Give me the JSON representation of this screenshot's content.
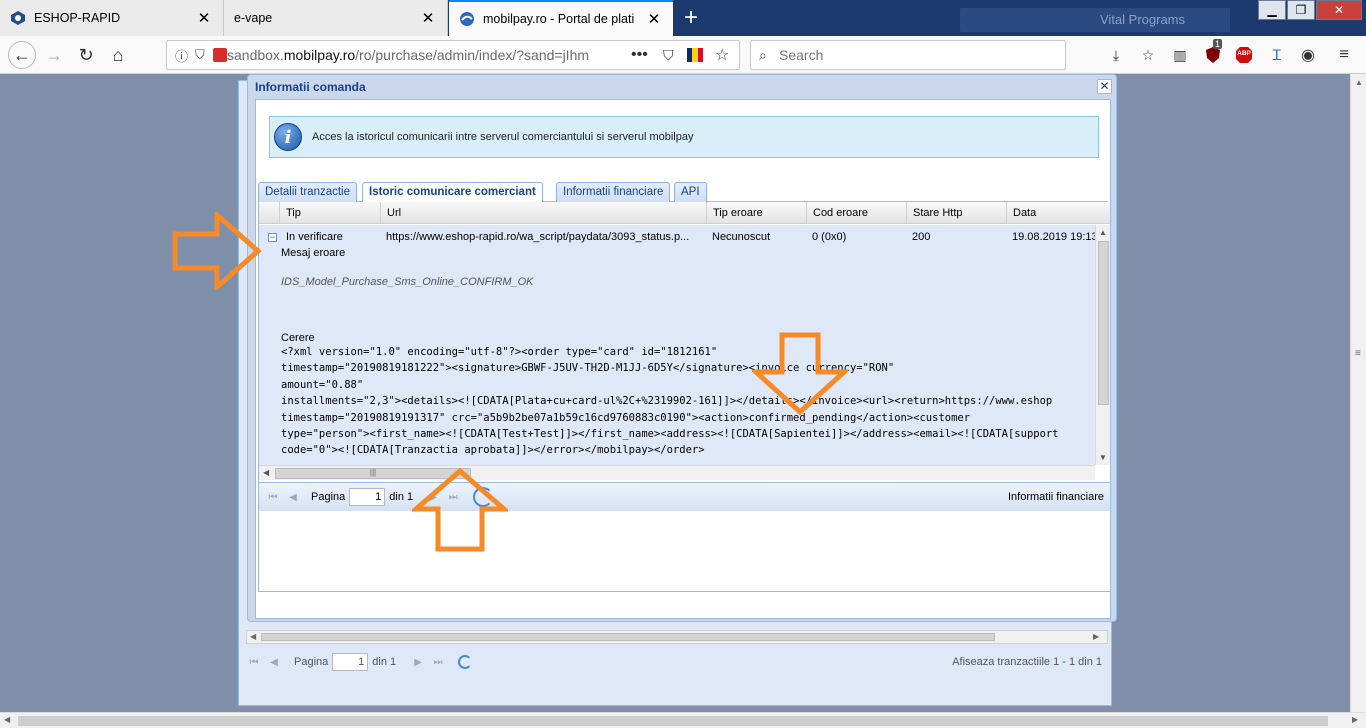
{
  "browser": {
    "tabs": [
      {
        "label": "ESHOP-RAPID",
        "active": false
      },
      {
        "label": "e-vape",
        "active": false
      },
      {
        "label": "mobilpay.ro - Portal de plati",
        "active": true
      }
    ],
    "background_text": "Vital Programs",
    "url_prefix": "sandbox.",
    "url_domain": "mobilpay.ro",
    "url_path": "/ro/purchase/admin/index/?sand=jIhm",
    "search_placeholder": "Search",
    "badge_count": "1",
    "abp_label": "ABP"
  },
  "modal": {
    "title": "Informatii comanda",
    "info_text": "Acces la istoricul comunicarii intre serverul comerciantului si serverul mobilpay",
    "tabs": [
      "Detalii tranzactie",
      "Istoric comunicare comerciant",
      "Informatii financiare",
      "API"
    ],
    "columns": [
      "Tip",
      "Url",
      "Tip eroare",
      "Cod eroare",
      "Stare Http",
      "Data"
    ],
    "row": {
      "tip": "In verificare",
      "url": "https://www.eshop-rapid.ro/wa_script/paydata/3093_status.p...",
      "tip_eroare": "Necunoscut",
      "cod_eroare": "0 (0x0)",
      "stare_http": "200",
      "data": "19.08.2019 19:13"
    },
    "detail": {
      "error_label": "Mesaj eroare",
      "error_value": "IDS_Model_Purchase_Sms_Online_CONFIRM_OK",
      "request_label": "Cerere",
      "xml_lines": [
        "<?xml version=\"1.0\" encoding=\"utf-8\"?><order type=\"card\" id=\"1812161\"",
        "timestamp=\"20190819181222\"><signature>GBWF-J5UV-TH2D-M1JJ-6D5Y</signature><invoice currency=\"RON\"",
        "amount=\"0.88\"",
        "installments=\"2,3\"><details><![CDATA[Plata+cu+card-ul%2C+%2319902-161]]></details></invoice><url><return>https://www.eshop",
        "timestamp=\"20190819191317\" crc=\"a5b9b2be07a1b59c16cd9760883c0190\"><action>confirmed_pending</action><customer",
        "type=\"person\"><first_name><![CDATA[Test+Test]]></first_name><address><![CDATA[Sapientei]]></address><email><![CDATA[support",
        "code=\"0\"><![CDATA[Tranzactia aprobata]]></error></mobilpay></order>"
      ]
    },
    "pager": {
      "page_label": "Pagina",
      "page_value": "1",
      "of_label": "din 1",
      "right_text": "Informatii financiare"
    }
  },
  "background_grid": {
    "page_label": "Pagina",
    "page_value": "1",
    "of_label": "din 1",
    "summary": "Afiseaza tranzactiile 1 - 1 din 1"
  },
  "colors": {
    "accent_arrow": "#f58a26",
    "tabbar": "#1d3a6e",
    "ext_header": "#15428b"
  }
}
